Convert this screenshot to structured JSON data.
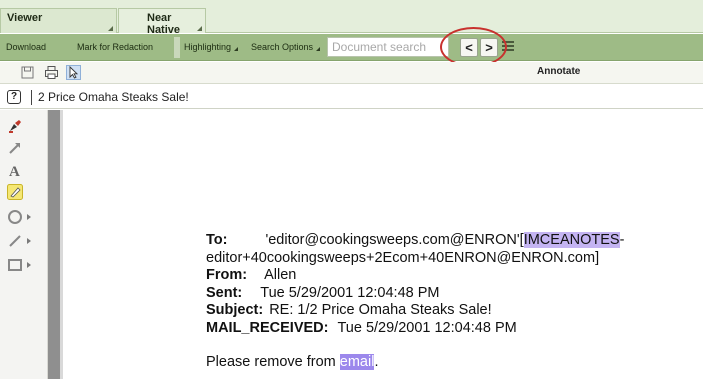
{
  "tabs": [
    {
      "label": "Viewer"
    },
    {
      "label": "Near Native"
    }
  ],
  "toolbar": {
    "download": "Download",
    "mark_for_redaction": "Mark for Redaction",
    "highlighting": "Highlighting",
    "search_options": "Search Options",
    "search_placeholder": "Document search",
    "prev_label": "<",
    "next_label": ">"
  },
  "annotate_bar": {
    "label": "Annotate"
  },
  "document": {
    "title": "2 Price Omaha Steaks Sale!"
  },
  "email": {
    "to_label": "To:",
    "to_value": "'editor@cookingsweeps.com@ENRON'[",
    "to_highlight": "IMCEANOTES",
    "to_tail": "-",
    "to_line2": "editor+40cookingsweeps+2Ecom+40ENRON@ENRON.com]",
    "from_label": "From:",
    "from_value": "Allen",
    "sent_label": "Sent:",
    "sent_value": "Tue 5/29/2001 12:04:48 PM",
    "subject_label": "Subject:",
    "subject_value": "RE: 1/2 Price Omaha Steaks Sale!",
    "received_label": "MAIL_RECEIVED:",
    "received_value": "Tue 5/29/2001 12:04:48 PM",
    "body_prefix": "Please remove from ",
    "body_highlight": "email",
    "body_suffix": "."
  },
  "colors": {
    "tab_bg": "#e4eedb",
    "toolbar_bg": "#9ebb86",
    "highlight_oval": "#c8312e",
    "search_highlight": "#c4b4f2"
  }
}
